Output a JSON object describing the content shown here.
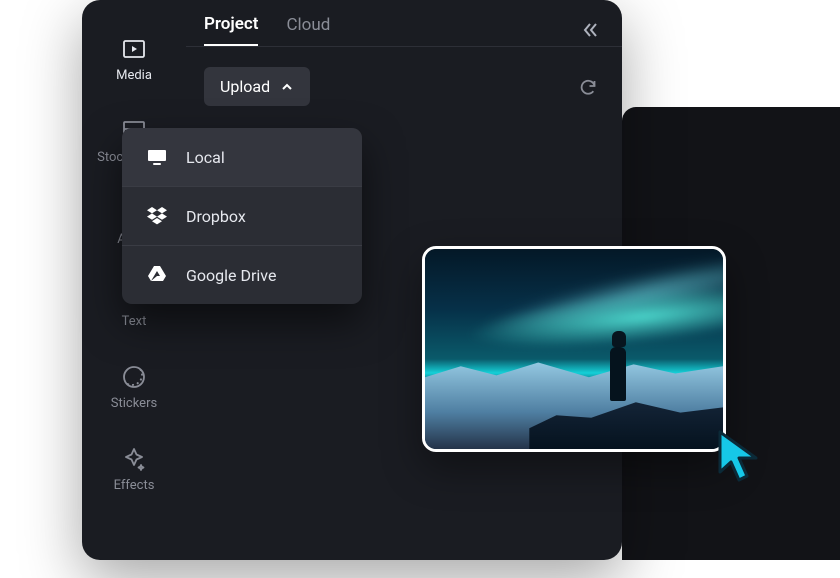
{
  "sidebar": {
    "items": [
      {
        "label": "Media",
        "icon": "media-icon"
      },
      {
        "label": "Stock videos",
        "icon": "stock-icon"
      },
      {
        "label": "Audio",
        "icon": "audio-icon"
      },
      {
        "label": "Text",
        "icon": "text-icon"
      },
      {
        "label": "Stickers",
        "icon": "stickers-icon"
      },
      {
        "label": "Effects",
        "icon": "effects-icon"
      }
    ],
    "active_index": 0
  },
  "tabs": {
    "items": [
      "Project",
      "Cloud"
    ],
    "active_index": 0
  },
  "toolbar": {
    "upload_label": "Upload"
  },
  "upload_menu": {
    "items": [
      {
        "label": "Local",
        "icon": "local-icon"
      },
      {
        "label": "Dropbox",
        "icon": "dropbox-icon"
      },
      {
        "label": "Google Drive",
        "icon": "google-drive-icon"
      }
    ]
  },
  "thumbnail": {
    "description": "aurora-landscape"
  }
}
